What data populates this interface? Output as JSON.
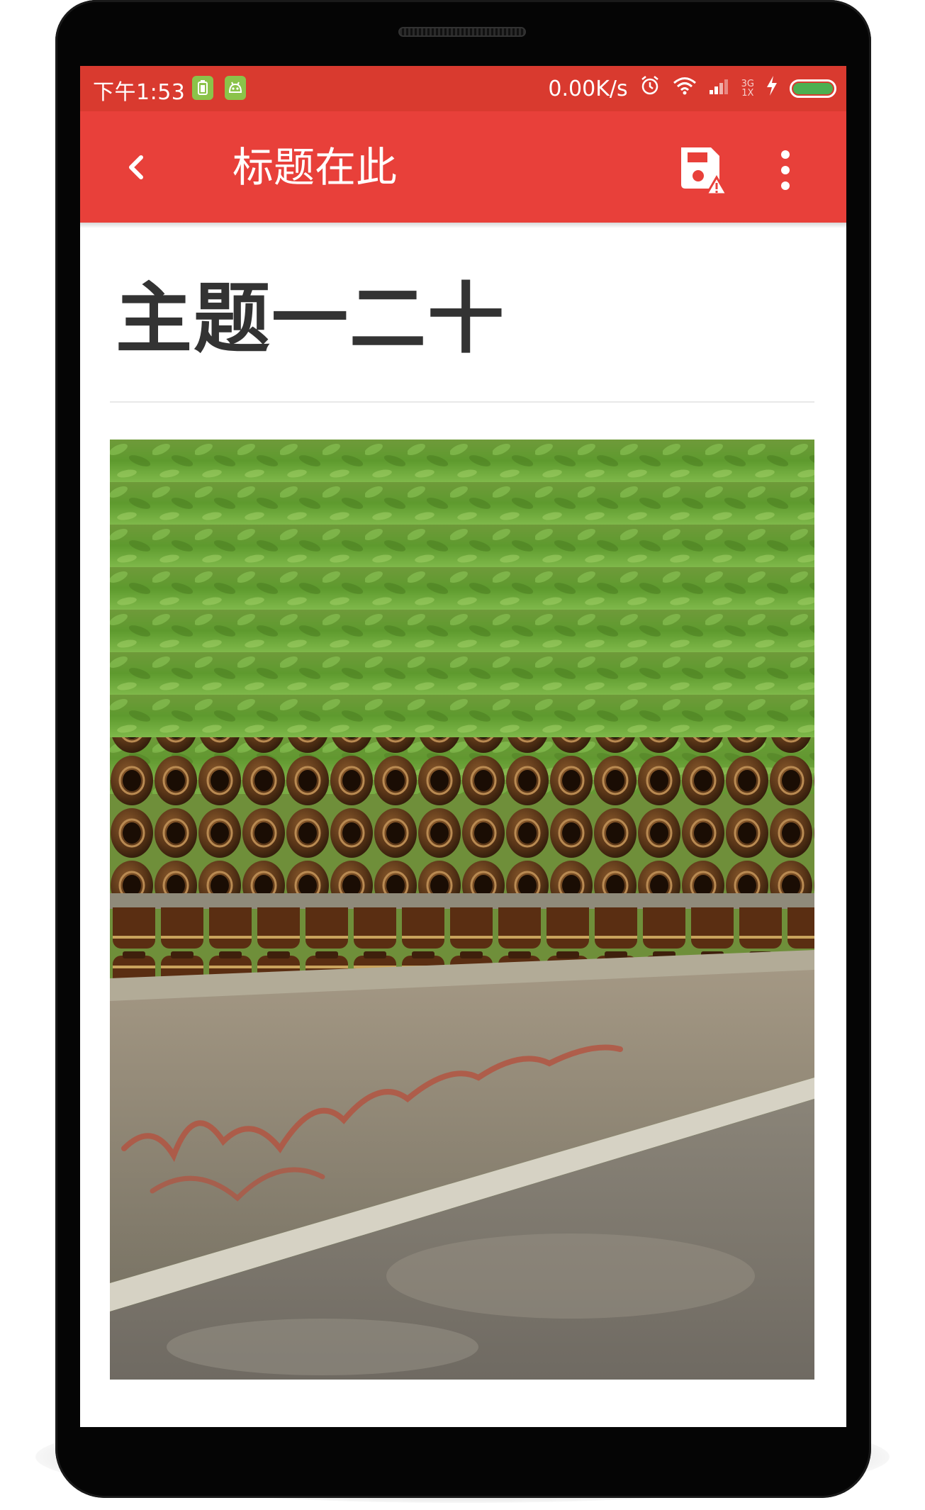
{
  "status_bar": {
    "time": "下午1:53",
    "network_speed": "0.00K/s",
    "network_type_top": "3G",
    "network_type_bottom": "1X",
    "battery_level": 1.0,
    "icons": [
      "battery-saver-icon",
      "android-icon",
      "alarm-icon",
      "wifi-icon",
      "signal-icon",
      "charging-icon",
      "battery-icon"
    ]
  },
  "toolbar": {
    "title": "标题在此",
    "back_icon": "chevron-left-icon",
    "save_icon": "save-warning-icon",
    "more_icon": "more-vertical-icon"
  },
  "article": {
    "title": "主题一二十",
    "image_description_icon": "photo"
  },
  "colors": {
    "status_bar": "#d93a2f",
    "toolbar": "#e8403a",
    "title_text": "#333333",
    "battery_fill": "#4caf50"
  }
}
